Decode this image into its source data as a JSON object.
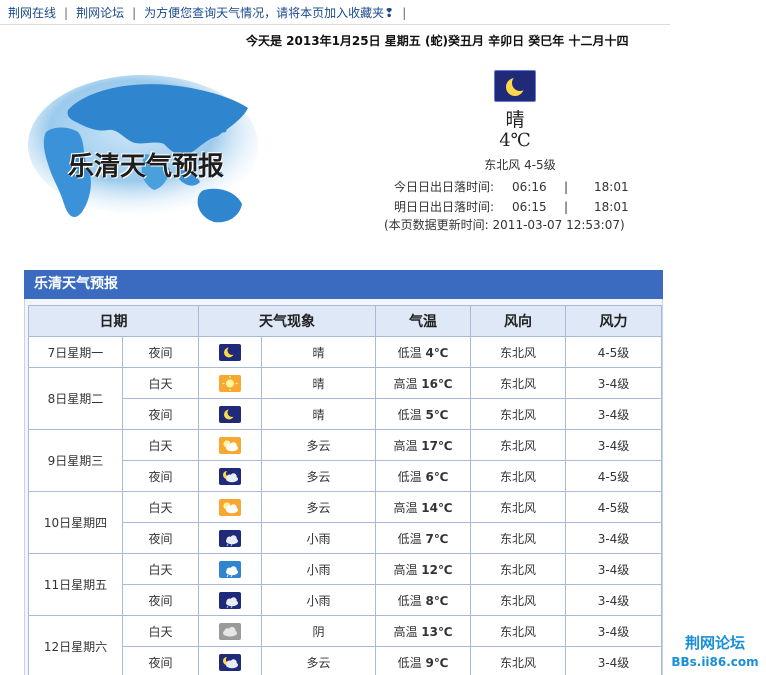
{
  "topnav": {
    "links": [
      "荆网在线",
      "荆网论坛",
      "为方便您查询天气情况，请将本页加入收藏夹❢"
    ],
    "separator": "|"
  },
  "dateline": "今天是 2013年1月25日 星期五 (蛇)癸丑月 辛卯日 癸巳年 十二月十四",
  "map_title": "乐清天气预报",
  "now": {
    "icon": "moon-icon",
    "condition": "晴",
    "temperature": "4℃",
    "wind": "东北风 4-5级",
    "today_sun": {
      "label": "今日日出日落时间:",
      "sunrise": "06:16",
      "sep": "|",
      "sunset": "18:01"
    },
    "tomorrow_sun": {
      "label": "明日日出日落时间:",
      "sunrise": "06:15",
      "sep": "|",
      "sunset": "18:01"
    },
    "update": "(本页数据更新时间: 2011-03-07 12:53:07)"
  },
  "forecast": {
    "title": "乐清天气预报",
    "headers": [
      "日期",
      "天气现象",
      "气温",
      "风向",
      "风力"
    ],
    "days": [
      {
        "date": "7日星期一",
        "rows": [
          {
            "period": "夜间",
            "icon": "moon-icon",
            "weather": "晴",
            "temp_label": "低温",
            "temp": "4℃",
            "wind_dir": "东北风",
            "wind_force": "4-5级"
          }
        ]
      },
      {
        "date": "8日星期二",
        "rows": [
          {
            "period": "白天",
            "icon": "sun-icon",
            "weather": "晴",
            "temp_label": "高温",
            "temp": "16℃",
            "wind_dir": "东北风",
            "wind_force": "3-4级"
          },
          {
            "period": "夜间",
            "icon": "moon-icon",
            "weather": "晴",
            "temp_label": "低温",
            "temp": "5℃",
            "wind_dir": "东北风",
            "wind_force": "3-4级"
          }
        ]
      },
      {
        "date": "9日星期三",
        "rows": [
          {
            "period": "白天",
            "icon": "sun-cloud-icon",
            "weather": "多云",
            "temp_label": "高温",
            "temp": "17℃",
            "wind_dir": "东北风",
            "wind_force": "3-4级"
          },
          {
            "period": "夜间",
            "icon": "moon-cloud-icon",
            "weather": "多云",
            "temp_label": "低温",
            "temp": "6℃",
            "wind_dir": "东北风",
            "wind_force": "4-5级"
          }
        ]
      },
      {
        "date": "10日星期四",
        "rows": [
          {
            "period": "白天",
            "icon": "sun-cloud-icon",
            "weather": "多云",
            "temp_label": "高温",
            "temp": "14℃",
            "wind_dir": "东北风",
            "wind_force": "4-5级"
          },
          {
            "period": "夜间",
            "icon": "night-rain-icon",
            "weather": "小雨",
            "temp_label": "低温",
            "temp": "7℃",
            "wind_dir": "东北风",
            "wind_force": "3-4级"
          }
        ]
      },
      {
        "date": "11日星期五",
        "rows": [
          {
            "period": "白天",
            "icon": "rain-icon",
            "weather": "小雨",
            "temp_label": "高温",
            "temp": "12℃",
            "wind_dir": "东北风",
            "wind_force": "3-4级"
          },
          {
            "period": "夜间",
            "icon": "night-rain-icon",
            "weather": "小雨",
            "temp_label": "低温",
            "temp": "8℃",
            "wind_dir": "东北风",
            "wind_force": "3-4级"
          }
        ]
      },
      {
        "date": "12日星期六",
        "rows": [
          {
            "period": "白天",
            "icon": "overcast-icon",
            "weather": "阴",
            "temp_label": "高温",
            "temp": "13℃",
            "wind_dir": "东北风",
            "wind_force": "3-4级"
          },
          {
            "period": "夜间",
            "icon": "moon-cloud-icon",
            "weather": "多云",
            "temp_label": "低温",
            "temp": "9℃",
            "wind_dir": "东北风",
            "wind_force": "3-4级"
          }
        ]
      }
    ]
  },
  "watermark": {
    "line1": "荆网论坛",
    "line2": "BBs.ii86.com"
  }
}
